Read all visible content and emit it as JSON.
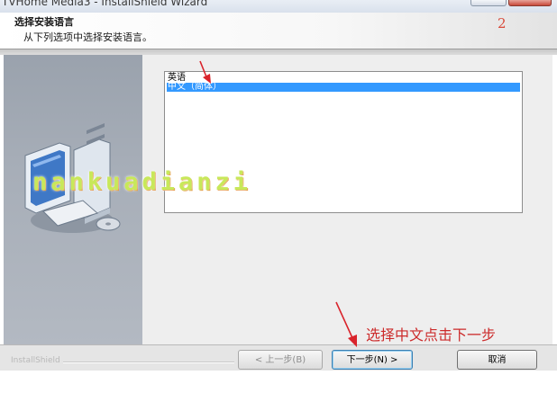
{
  "window": {
    "title": "TVHome Media3 - InstallShield Wizard"
  },
  "header": {
    "title": "选择安装语言",
    "subtitle": "从下列选项中选择安装语言。",
    "step_number": "2"
  },
  "language_list": {
    "items": [
      {
        "label": "英语",
        "selected": false
      },
      {
        "label": "中文（简体）",
        "selected": true
      }
    ]
  },
  "footer": {
    "brand": "InstallShield",
    "back_label": "< 上一步(B)",
    "next_label": "下一步(N) >",
    "cancel_label": "取消"
  },
  "annotation": {
    "text": "选择中文点击下一步"
  },
  "watermark": {
    "text": "nankuadianzi"
  },
  "colors": {
    "selection": "#3399ff",
    "annotation": "#cc2b2b",
    "sidebar": "#a7aeb8"
  }
}
